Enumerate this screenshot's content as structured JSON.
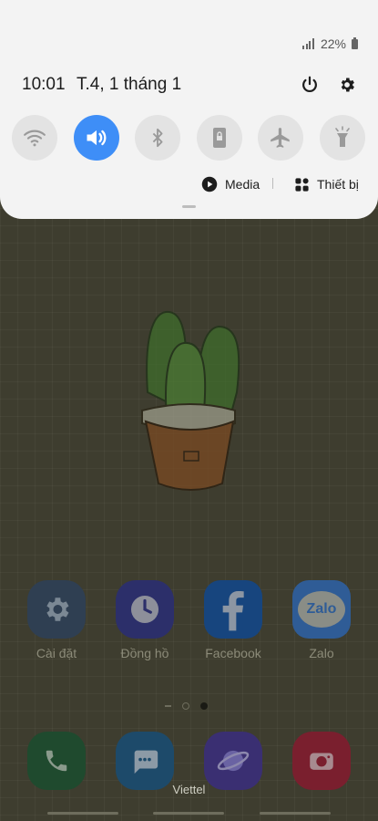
{
  "status_bar": {
    "battery_text": "22%"
  },
  "quick_panel": {
    "time": "10:01",
    "date": "T.4, 1 tháng 1",
    "tiles": [
      {
        "name": "wifi",
        "active": false
      },
      {
        "name": "sound",
        "active": true
      },
      {
        "name": "bluetooth",
        "active": false
      },
      {
        "name": "portrait-lock",
        "active": false
      },
      {
        "name": "airplane",
        "active": false
      },
      {
        "name": "flashlight",
        "active": false
      }
    ],
    "media_label": "Media",
    "devices_label": "Thiết bị",
    "accent_color": "#3e8ef7"
  },
  "home": {
    "apps": [
      {
        "label": "Cài đặt",
        "icon": "gear-icon"
      },
      {
        "label": "Đồng hồ",
        "icon": "clock-icon"
      },
      {
        "label": "Facebook",
        "icon": "facebook-icon"
      },
      {
        "label": "Zalo",
        "icon": "zalo-icon",
        "icon_text": "Zalo"
      }
    ],
    "dock": [
      {
        "icon": "phone-icon"
      },
      {
        "icon": "messages-icon"
      },
      {
        "icon": "internet-icon"
      },
      {
        "icon": "camera-icon"
      }
    ],
    "page_indicator": {
      "pages": 3,
      "current": 3
    },
    "carrier": "Viettel"
  }
}
